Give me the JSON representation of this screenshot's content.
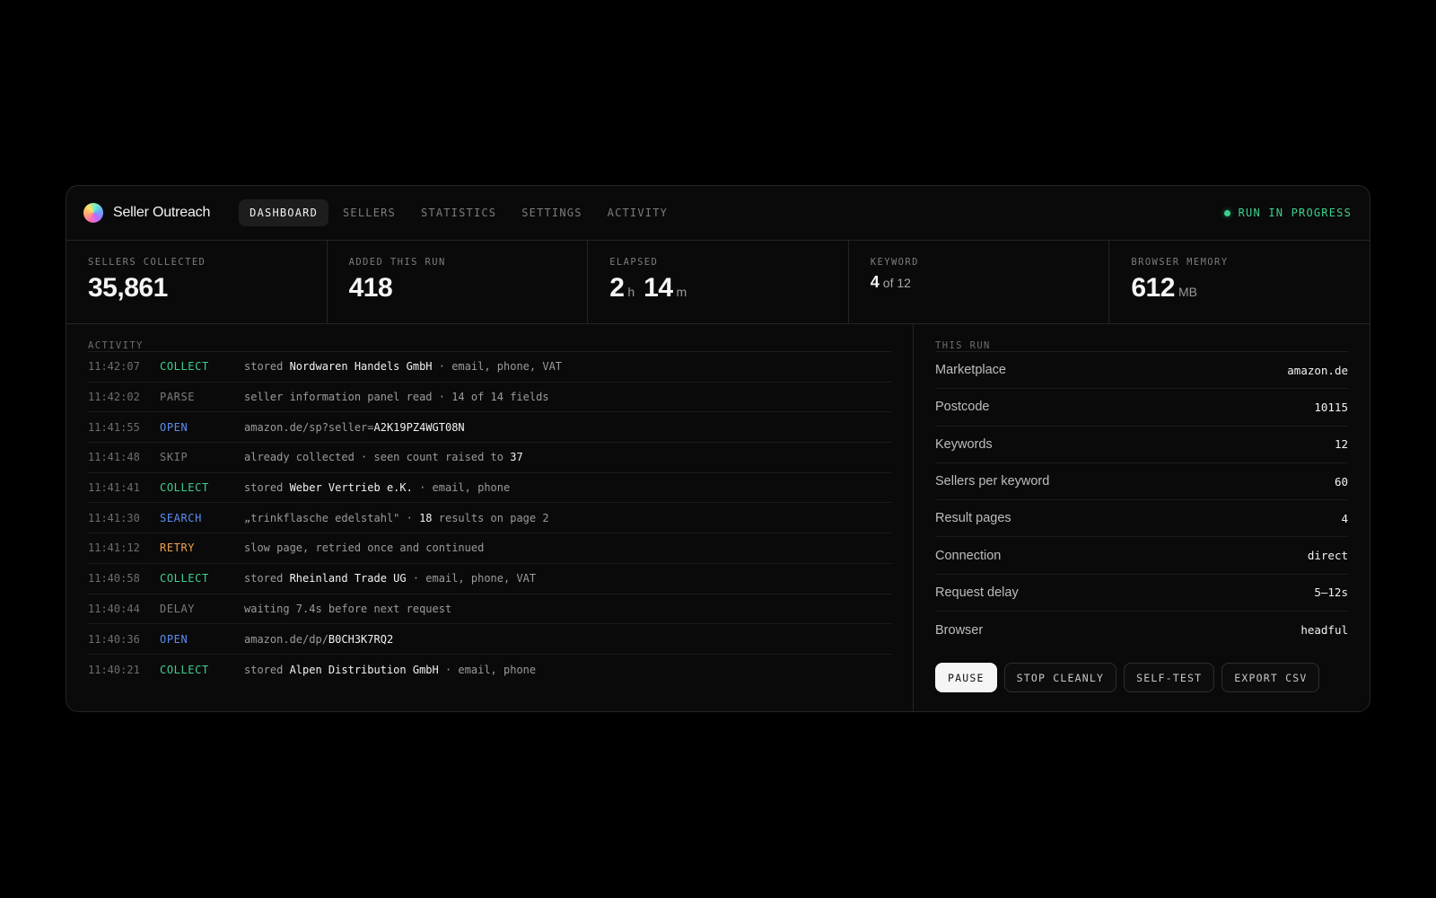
{
  "brand": {
    "name": "Seller Outreach"
  },
  "nav": {
    "tabs": [
      "DASHBOARD",
      "SELLERS",
      "STATISTICS",
      "SETTINGS",
      "ACTIVITY"
    ]
  },
  "status": {
    "text": "RUN IN PROGRESS",
    "color": "#3ecf8e"
  },
  "stats": {
    "sellers_collected": {
      "label": "SELLERS COLLECTED",
      "value": "35,861"
    },
    "added_this_run": {
      "label": "ADDED THIS RUN",
      "value": "418"
    },
    "elapsed": {
      "label": "ELAPSED",
      "hours": "2",
      "hours_unit": "h",
      "minutes": "14",
      "minutes_unit": "m"
    },
    "keyword": {
      "label": "KEYWORD",
      "current": "4",
      "of_text": "of 12"
    },
    "browser_memory": {
      "label": "BROWSER MEMORY",
      "value": "612",
      "unit": "MB"
    }
  },
  "activity": {
    "label": "ACTIVITY",
    "rows": [
      {
        "time": "11:42:07",
        "type": "COLLECT",
        "pre": "stored ",
        "hl": "Nordwaren Handels GmbH",
        "post": " · email, phone, VAT"
      },
      {
        "time": "11:42:02",
        "type": "PARSE",
        "pre": "seller information panel read · 14 of 14 fields",
        "hl": "",
        "post": ""
      },
      {
        "time": "11:41:55",
        "type": "OPEN",
        "pre": "amazon.de/sp?seller=",
        "hl": "A2K19PZ4WGT08N",
        "post": ""
      },
      {
        "time": "11:41:48",
        "type": "SKIP",
        "pre": "already collected · seen count raised to ",
        "hl": "37",
        "post": ""
      },
      {
        "time": "11:41:41",
        "type": "COLLECT",
        "pre": "stored ",
        "hl": "Weber Vertrieb e.K.",
        "post": " · email, phone"
      },
      {
        "time": "11:41:30",
        "type": "SEARCH",
        "pre": "„trinkflasche edelstahl\" · ",
        "hl": "18",
        "post": " results on page 2"
      },
      {
        "time": "11:41:12",
        "type": "RETRY",
        "pre": "slow page, retried once and continued",
        "hl": "",
        "post": ""
      },
      {
        "time": "11:40:58",
        "type": "COLLECT",
        "pre": "stored ",
        "hl": "Rheinland Trade UG",
        "post": " · email, phone, VAT"
      },
      {
        "time": "11:40:44",
        "type": "DELAY",
        "pre": "waiting 7.4s before next request",
        "hl": "",
        "post": ""
      },
      {
        "time": "11:40:36",
        "type": "OPEN",
        "pre": "amazon.de/dp/",
        "hl": "B0CH3K7RQ2",
        "post": ""
      },
      {
        "time": "11:40:21",
        "type": "COLLECT",
        "pre": "stored ",
        "hl": "Alpen Distribution GmbH",
        "post": " · email, phone"
      }
    ]
  },
  "run": {
    "label": "THIS RUN",
    "rows": [
      {
        "key": "Marketplace",
        "value": "amazon.de"
      },
      {
        "key": "Postcode",
        "value": "10115"
      },
      {
        "key": "Keywords",
        "value": "12"
      },
      {
        "key": "Sellers per keyword",
        "value": "60"
      },
      {
        "key": "Result pages",
        "value": "4"
      },
      {
        "key": "Connection",
        "value": "direct"
      },
      {
        "key": "Request delay",
        "value": "5–12s"
      },
      {
        "key": "Browser",
        "value": "headful"
      }
    ],
    "actions": [
      "PAUSE",
      "STOP CLEANLY",
      "SELF-TEST",
      "EXPORT CSV"
    ]
  }
}
